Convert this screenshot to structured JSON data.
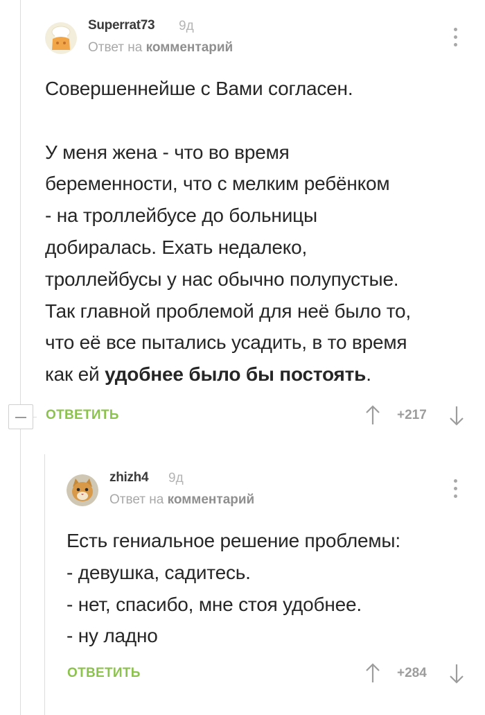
{
  "comments": [
    {
      "username": "Superrat73",
      "time": "9д",
      "reply_prefix": "Ответ на ",
      "reply_link": "комментарий",
      "body": [
        "Совершеннейше с Вами согласен.",
        "",
        "У меня жена - что во время",
        "беременности, что с мелким ребёнком",
        "- на троллейбусе до больницы",
        "добиралась. Ехать недалеко,",
        "троллейбусы у нас обычно полупустые.",
        "Так главной проблемой для неё было то,",
        "что её все пытались усадить, в то время"
      ],
      "last_line_prefix": "как ей ",
      "last_line_bold": "удобнее было бы постоять",
      "last_line_suffix": ".",
      "reply_label": "ОТВЕТИТЬ",
      "rating": "+217",
      "avatar_icon": "chef-hat-avatar"
    },
    {
      "username": "zhizh4",
      "time": "9д",
      "reply_prefix": "Ответ на ",
      "reply_link": "комментарий",
      "body": [
        "Есть гениальное решение проблемы:",
        "- девушка, садитесь.",
        "- нет, спасибо, мне стоя удобнее.",
        "- ну ладно"
      ],
      "reply_label": "ОТВЕТИТЬ",
      "rating": "+284",
      "avatar_icon": "cat-avatar"
    }
  ],
  "colors": {
    "accent_green": "#8cc24e",
    "muted_gray": "#a8a8a8",
    "thread_line": "#dcdcdc"
  }
}
